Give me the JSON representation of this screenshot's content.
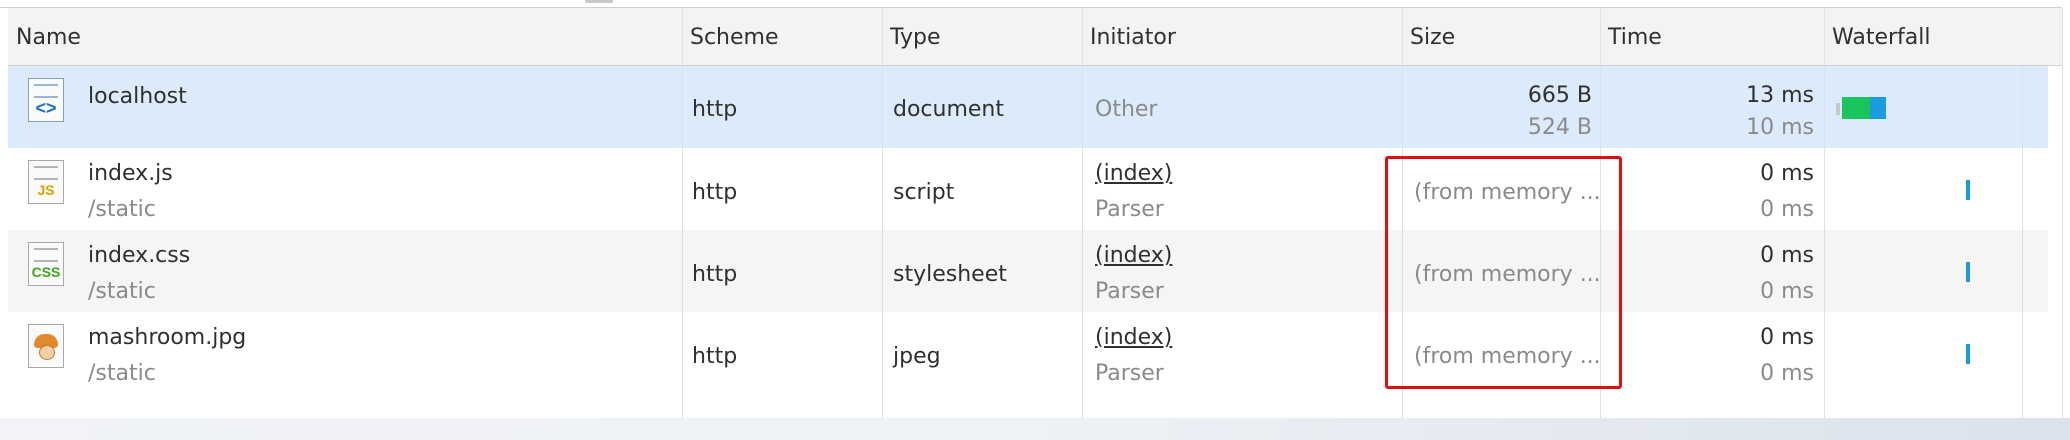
{
  "header": {
    "columns": [
      "Name",
      "Scheme",
      "Type",
      "Initiator",
      "Size",
      "Time",
      "Waterfall"
    ]
  },
  "rows": [
    {
      "name": "localhost",
      "path": "",
      "scheme": "http",
      "type": "document",
      "initiator": "Other",
      "initiator_sub": "",
      "size": "665 B",
      "size_sub": "524 B",
      "time": "13 ms",
      "time_sub": "10 ms",
      "icon": "html-file-icon"
    },
    {
      "name": "index.js",
      "path": "/static",
      "scheme": "http",
      "type": "script",
      "initiator": "(index)",
      "initiator_sub": "Parser",
      "size": "(from memory ...",
      "size_sub": "",
      "time": "0 ms",
      "time_sub": "0 ms",
      "icon": "js-file-icon",
      "icon_label": "JS"
    },
    {
      "name": "index.css",
      "path": "/static",
      "scheme": "http",
      "type": "stylesheet",
      "initiator": "(index)",
      "initiator_sub": "Parser",
      "size": "(from memory ...",
      "size_sub": "",
      "time": "0 ms",
      "time_sub": "0 ms",
      "icon": "css-file-icon",
      "icon_label": "CSS"
    },
    {
      "name": "mashroom.jpg",
      "path": "/static",
      "scheme": "http",
      "type": "jpeg",
      "initiator": "(index)",
      "initiator_sub": "Parser",
      "size": "(from memory ...",
      "size_sub": "",
      "time": "0 ms",
      "time_sub": "0 ms",
      "icon": "image-file-icon"
    }
  ],
  "colors": {
    "selected_row": "#dcebfb",
    "highlight_box": "#e01010",
    "waterfall_blue": "#1a9be0",
    "waterfall_green": "#19c45a"
  }
}
